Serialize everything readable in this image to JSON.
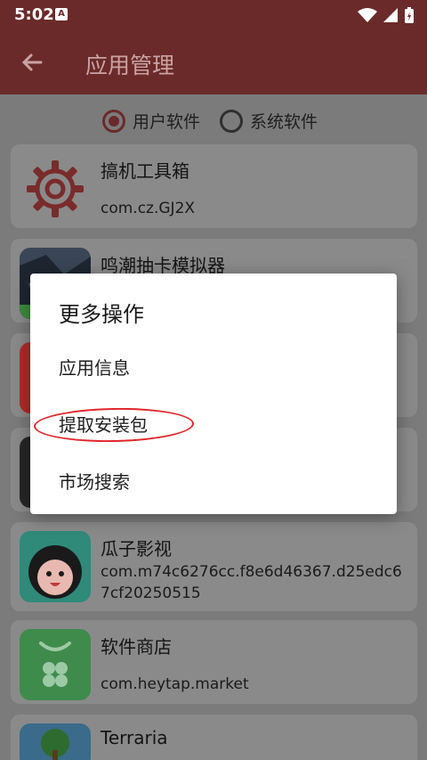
{
  "status_bar": {
    "time": "5:02",
    "notification_badge": "A"
  },
  "app_bar": {
    "title": "应用管理",
    "back_icon": "arrow-left-icon"
  },
  "filter": {
    "options": [
      {
        "label": "用户软件",
        "selected": true
      },
      {
        "label": "系统软件",
        "selected": false
      }
    ]
  },
  "apps": [
    {
      "name": "搞机工具箱",
      "package": "com.cz.GJ2X",
      "icon": "gear-icon"
    },
    {
      "name": "鸣潮抽卡模拟器",
      "package": "",
      "icon": "game-icon"
    },
    {
      "name": "",
      "package": "",
      "icon": "app-icon-red"
    },
    {
      "name": "",
      "package": "",
      "icon": "app-icon-dark"
    },
    {
      "name": "瓜子影视",
      "package": "com.m74c6276cc.f8e6d46367.d25edc67cf20250515",
      "icon": "character-icon"
    },
    {
      "name": "软件商店",
      "package": "com.heytap.market",
      "icon": "store-icon"
    },
    {
      "name": "Terraria",
      "package": "",
      "icon": "tree-icon"
    }
  ],
  "dialog": {
    "title": "更多操作",
    "items": [
      "应用信息",
      "提取安装包",
      "市场搜索"
    ],
    "highlighted_item": "提取安装包"
  },
  "colors": {
    "primary": "#6b2a2a",
    "annotation": "#e0262b"
  }
}
